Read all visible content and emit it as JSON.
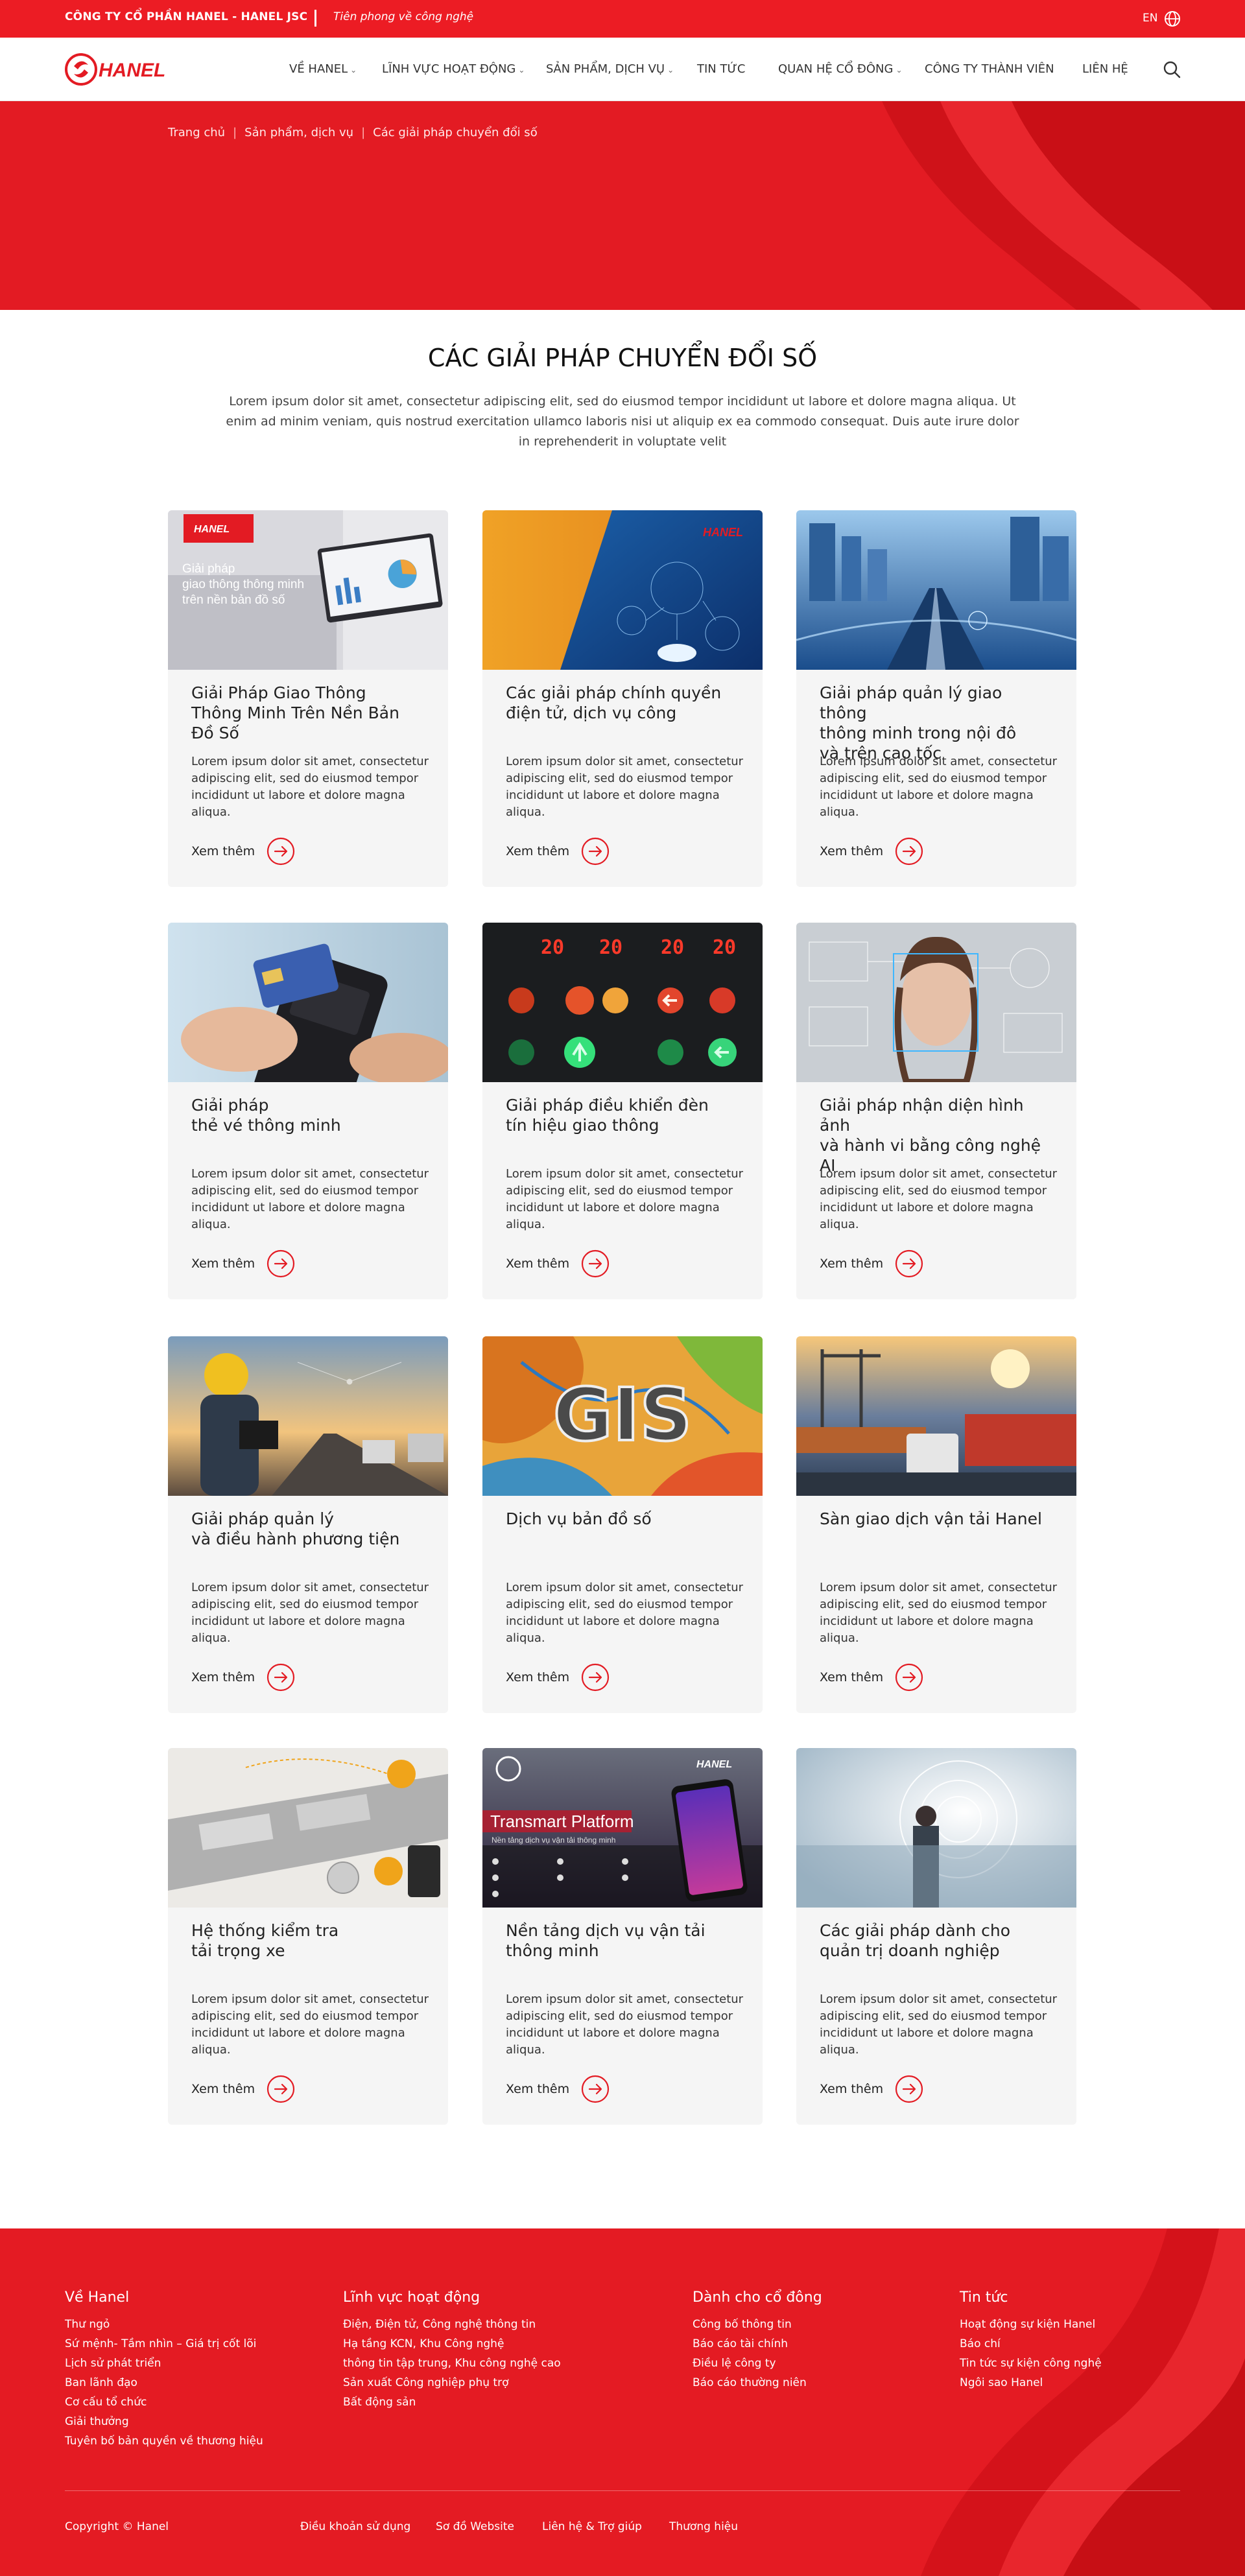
{
  "topbar": {
    "company": "CÔNG TY CỔ PHẦN HANEL - HANEL JSC",
    "slogan": "Tiên phong về công nghệ",
    "lang": "EN"
  },
  "nav": {
    "logo_text": "HANEL",
    "items": [
      {
        "label": "VỀ HANEL",
        "dropdown": true
      },
      {
        "label": "LĨNH VỰC HOẠT ĐỘNG",
        "dropdown": true
      },
      {
        "label": "SẢN PHẨM, DỊCH VỤ",
        "dropdown": true
      },
      {
        "label": "TIN TỨC",
        "dropdown": false
      },
      {
        "label": "QUAN HỆ CỔ ĐÔNG",
        "dropdown": true
      },
      {
        "label": "CÔNG TY THÀNH VIÊN",
        "dropdown": false
      },
      {
        "label": "LIÊN HỆ",
        "dropdown": false
      }
    ]
  },
  "breadcrumb": [
    "Trang chủ",
    "Sản phẩm, dịch vụ",
    "Các giải pháp chuyển đổi số"
  ],
  "page": {
    "title": "CÁC GIẢI PHÁP CHUYỂN ĐỔI SỐ",
    "intro": "Lorem ipsum dolor sit amet, consectetur adipiscing elit, sed do eiusmod tempor incididunt ut labore et dolore magna aliqua. Ut enim ad minim veniam, quis nostrud exercitation ullamco laboris nisi ut aliquip ex ea commodo consequat. Duis aute irure dolor in reprehenderit in voluptate velit"
  },
  "cards": [
    {
      "title": "Giải Pháp Giao Thông\nThông Minh Trên Nền Bản\nĐồ Số",
      "desc": "Lorem ipsum dolor sit amet, consectetur adipiscing elit, sed do eiusmod tempor incididunt ut labore et dolore magna aliqua.",
      "more": "Xem thêm",
      "image_text": "Giải pháp\ngiao thông thông minh\ntrên nền bản đồ số",
      "image_logo": "HANEL"
    },
    {
      "title": "Các giải pháp chính quyền\nđiện tử, dịch vụ công",
      "desc": "Lorem ipsum dolor sit amet, consectetur adipiscing elit, sed do eiusmod tempor incididunt ut labore et dolore magna aliqua.",
      "more": "Xem thêm",
      "image_logo": "HANEL"
    },
    {
      "title": "Giải pháp quản lý giao thông\nthông minh trong nội đô\nvà trên cao tốc",
      "desc": "Lorem ipsum dolor sit amet, consectetur adipiscing elit, sed do eiusmod tempor incididunt ut labore et dolore magna aliqua.",
      "more": "Xem thêm"
    },
    {
      "title": "Giải pháp\nthẻ vé thông minh",
      "desc": "Lorem ipsum dolor sit amet, consectetur adipiscing elit, sed do eiusmod tempor incididunt ut labore et dolore magna aliqua.",
      "more": "Xem thêm"
    },
    {
      "title": "Giải pháp điều khiển đèn\ntín hiệu giao thông",
      "desc": "Lorem ipsum dolor sit amet, consectetur adipiscing elit, sed do eiusmod tempor incididunt ut labore et dolore magna aliqua.",
      "more": "Xem thêm",
      "image_text": "20"
    },
    {
      "title": "Giải pháp nhận diện hình ảnh\nvà hành vi bằng công nghệ AI",
      "desc": "Lorem ipsum dolor sit amet, consectetur adipiscing elit, sed do eiusmod tempor incididunt ut labore et dolore magna aliqua.",
      "more": "Xem thêm"
    },
    {
      "title": "Giải pháp quản lý\nvà điều hành phương tiện",
      "desc": "Lorem ipsum dolor sit amet, consectetur adipiscing elit, sed do eiusmod tempor incididunt ut labore et dolore magna aliqua.",
      "more": "Xem thêm"
    },
    {
      "title": "Dịch vụ bản đồ số",
      "desc": "Lorem ipsum dolor sit amet, consectetur adipiscing elit, sed do eiusmod tempor incididunt ut labore et dolore magna aliqua.",
      "more": "Xem thêm",
      "image_text": "GIS"
    },
    {
      "title": "Sàn giao dịch vận tải Hanel",
      "desc": "Lorem ipsum dolor sit amet, consectetur adipiscing elit, sed do eiusmod tempor incididunt ut labore et dolore magna aliqua.",
      "more": "Xem thêm"
    },
    {
      "title": "Hệ thống kiểm tra\ntải trọng xe",
      "desc": "Lorem ipsum dolor sit amet, consectetur adipiscing elit, sed do eiusmod tempor incididunt ut labore et dolore magna aliqua.",
      "more": "Xem thêm"
    },
    {
      "title": "Nền tảng dịch vụ vận tải\nthông minh",
      "desc": "Lorem ipsum dolor sit amet, consectetur adipiscing elit, sed do eiusmod tempor incididunt ut labore et dolore magna aliqua.",
      "more": "Xem thêm",
      "image_text": "Transmart Platform",
      "image_subtext": "Nền tảng dịch vụ vận tải thông minh",
      "image_logo": "HANEL"
    },
    {
      "title": "Các giải pháp dành cho\nquản trị doanh nghiệp",
      "desc": "Lorem ipsum dolor sit amet, consectetur adipiscing elit, sed do eiusmod tempor incididunt ut labore et dolore magna aliqua.",
      "more": "Xem thêm"
    }
  ],
  "footer": {
    "columns": [
      {
        "title": "Về Hanel",
        "links": [
          "Thư ngỏ",
          "Sứ mệnh- Tầm nhìn – Giá trị cốt lõi",
          "Lịch sử phát triển",
          "Ban lãnh đạo",
          "Cơ cấu tổ chức",
          "Giải thưởng",
          "Tuyên bố bản quyền về thương hiệu"
        ]
      },
      {
        "title": "Lĩnh vực hoạt động",
        "links": [
          "Điện, Điện tử, Công nghệ thông tin",
          "Hạ tầng KCN, Khu Công nghệ",
          "thông tin tập trung, Khu công nghệ cao",
          "Sản xuất Công nghiệp phụ trợ",
          "Bất động sản"
        ]
      },
      {
        "title": "Dành cho cổ đông",
        "links": [
          "Công bố thông tin",
          "Báo cáo tài chính",
          "Điều lệ công ty",
          "Báo cáo thường niên"
        ]
      },
      {
        "title": "Tin tức",
        "links": [
          "Hoạt động sự kiện Hanel",
          "Báo chí",
          "Tin tức sự kiện công nghệ",
          "Ngôi sao Hanel"
        ]
      }
    ],
    "copyright": "Copyright © Hanel",
    "bottom_links": [
      "Điều khoản sử dụng",
      "Sơ đồ Website",
      "Liên hệ & Trợ giúp",
      "Thương hiệu"
    ]
  },
  "colors": {
    "brand_red": "#ec1c24",
    "card_bg": "#f5f5f5"
  },
  "icons": [
    "globe-icon",
    "search-icon",
    "chevron-down-icon",
    "arrow-right-circle-icon",
    "hanel-logo"
  ]
}
